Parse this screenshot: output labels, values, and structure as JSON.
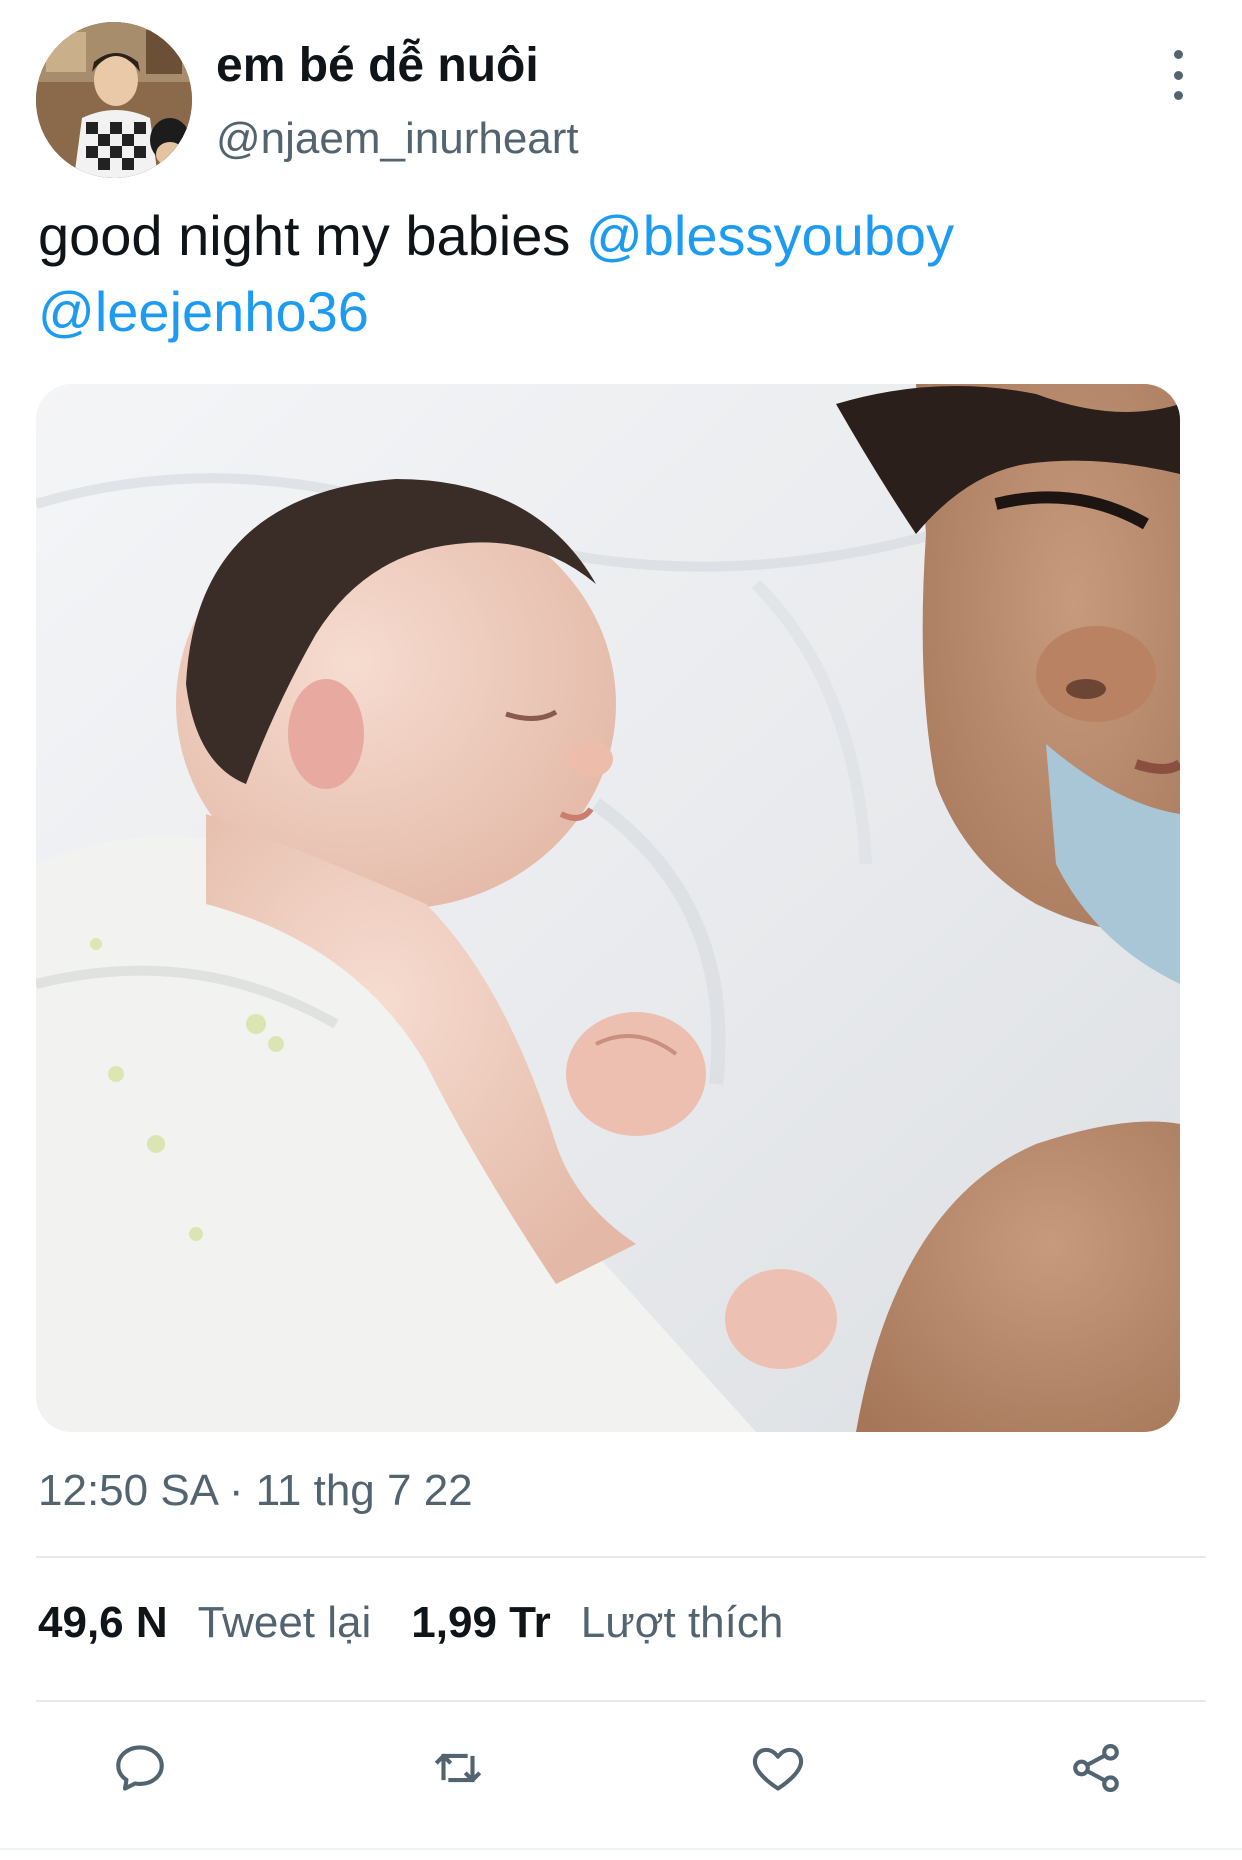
{
  "author": {
    "display_name": "em bé dễ nuôi",
    "handle": "@njaem_inurheart"
  },
  "tweet": {
    "text": "good night my babies",
    "mentions": [
      "@blessyouboy",
      "@leejenho36"
    ],
    "timestamp": "12:50 SA · 11 thg 7 22"
  },
  "stats": {
    "retweets_value": "49,6 N",
    "retweets_label": "Tweet lại",
    "likes_value": "1,99 Tr",
    "likes_label": "Lượt thích"
  },
  "icons": {
    "more": "more-vertical-icon",
    "reply": "reply-bubble-icon",
    "retweet": "retweet-icon",
    "like": "heart-icon",
    "share": "share-icon"
  },
  "colors": {
    "mention": "#1d9bf0",
    "secondary_text": "#536471",
    "primary_text": "#0f1419"
  }
}
